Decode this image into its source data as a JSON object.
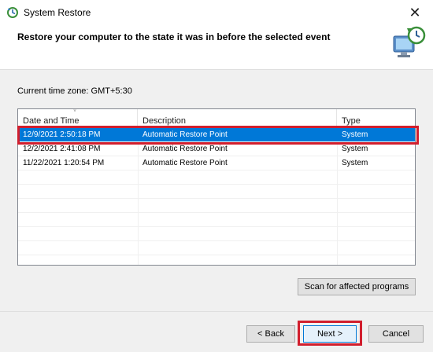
{
  "window": {
    "title": "System Restore",
    "close_glyph": "✕",
    "app_icon": "system-restore-icon"
  },
  "header": {
    "title": "Restore your computer to the state it was in before the selected event",
    "icon": "restore-monitor-clock-icon"
  },
  "timezone_label": "Current time zone: GMT+5:30",
  "list": {
    "columns": [
      "Date and Time",
      "Description",
      "Type"
    ],
    "sort_indicator": "˅",
    "rows": [
      {
        "date": "12/9/2021 2:50:18 PM",
        "description": "Automatic Restore Point",
        "type": "System",
        "selected": true
      },
      {
        "date": "12/2/2021 2:41:08 PM",
        "description": "Automatic Restore Point",
        "type": "System",
        "selected": false
      },
      {
        "date": "11/22/2021 1:20:54 PM",
        "description": "Automatic Restore Point",
        "type": "System",
        "selected": false
      }
    ]
  },
  "buttons": {
    "scan": "Scan for affected programs",
    "back": "< Back",
    "next": "Next >",
    "cancel": "Cancel"
  },
  "colors": {
    "selection": "#0078d7",
    "highlight_annotation": "#d11e2d"
  }
}
